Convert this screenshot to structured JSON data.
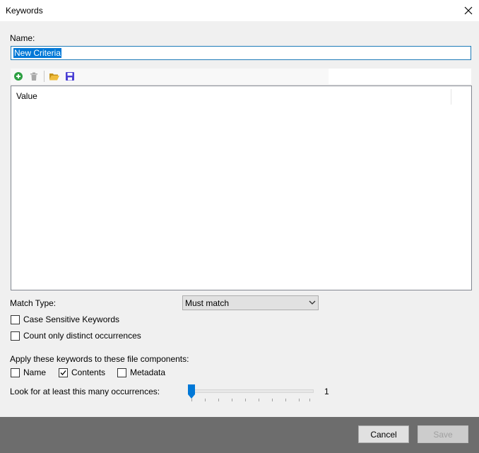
{
  "window": {
    "title": "Keywords"
  },
  "name_field": {
    "label": "Name:",
    "value": "New Criteria"
  },
  "toolbar": {
    "icons": [
      "add-icon",
      "delete-icon",
      "folder-open-icon",
      "save-icon"
    ]
  },
  "list": {
    "column_header": "Value"
  },
  "match_type": {
    "label": "Match Type:",
    "selected": "Must match"
  },
  "options": {
    "case_sensitive": {
      "label": "Case Sensitive Keywords",
      "checked": false
    },
    "distinct": {
      "label": "Count only distinct occurrences",
      "checked": false
    }
  },
  "components": {
    "label": "Apply these keywords to these file components:",
    "name": {
      "label": "Name",
      "checked": false
    },
    "contents": {
      "label": "Contents",
      "checked": true
    },
    "metadata": {
      "label": "Metadata",
      "checked": false
    }
  },
  "occurrences": {
    "label": "Look for at least this many occurrences:",
    "value": "1"
  },
  "buttons": {
    "cancel": "Cancel",
    "save": "Save"
  },
  "colors": {
    "accent": "#0078d7",
    "add_green": "#2ea043",
    "folder": "#e8b32a",
    "save_blue": "#4a3fd4",
    "footer": "#6d6d6d"
  }
}
